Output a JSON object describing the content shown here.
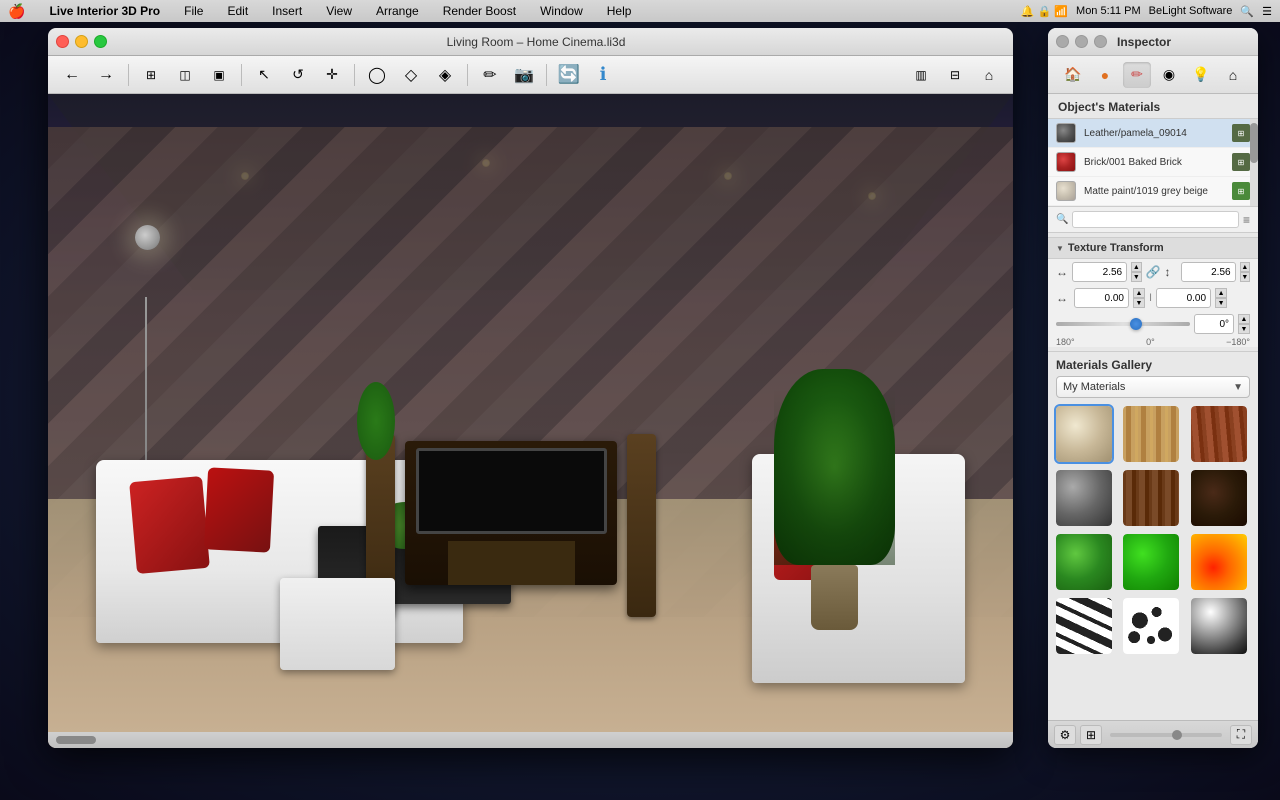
{
  "menubar": {
    "apple": "🍎",
    "app_name": "Live Interior 3D Pro",
    "items": [
      "File",
      "Edit",
      "Insert",
      "View",
      "Arrange",
      "Render Boost",
      "Window",
      "Help"
    ],
    "right": {
      "time": "Mon 5:11 PM",
      "brand": "BeLight Software"
    }
  },
  "window": {
    "title": "Living Room – Home Cinema.li3d",
    "traffic_lights": {
      "close": "close",
      "minimize": "minimize",
      "maximize": "maximize"
    }
  },
  "toolbar": {
    "buttons": [
      {
        "name": "back",
        "icon": "←",
        "label": "Back"
      },
      {
        "name": "forward",
        "icon": "→",
        "label": "Forward"
      },
      {
        "name": "floor-plan",
        "icon": "⊞",
        "label": "Floor Plan"
      },
      {
        "name": "elevation",
        "icon": "◫",
        "label": "Elevation"
      },
      {
        "name": "perspective",
        "icon": "▣",
        "label": "Perspective"
      },
      {
        "name": "select",
        "icon": "↖",
        "label": "Select"
      },
      {
        "name": "orbit",
        "icon": "↺",
        "label": "Orbit"
      },
      {
        "name": "pan",
        "icon": "✛",
        "label": "Pan"
      },
      {
        "name": "sphere-mode",
        "icon": "◯",
        "label": "Sphere"
      },
      {
        "name": "box-mode",
        "icon": "◇",
        "label": "Box"
      },
      {
        "name": "bump-mode",
        "icon": "◈",
        "label": "Bump"
      },
      {
        "name": "draw",
        "icon": "✏",
        "label": "Draw"
      },
      {
        "name": "camera",
        "icon": "📷",
        "label": "Camera"
      },
      {
        "name": "rotate-view",
        "icon": "🔄",
        "label": "Rotate View"
      },
      {
        "name": "info",
        "icon": "ℹ",
        "label": "Info"
      },
      {
        "name": "view-2d",
        "icon": "▥",
        "label": "2D View"
      },
      {
        "name": "view-rooms",
        "icon": "⊟",
        "label": "Rooms View"
      },
      {
        "name": "view-home",
        "icon": "⌂",
        "label": "Home View"
      }
    ]
  },
  "inspector": {
    "title": "Inspector",
    "tabs": [
      {
        "name": "tab-materials",
        "icon": "🏠",
        "active": false
      },
      {
        "name": "tab-sphere",
        "icon": "●",
        "active": false
      },
      {
        "name": "tab-paint",
        "icon": "✏",
        "active": true
      },
      {
        "name": "tab-texture",
        "icon": "◉",
        "active": false
      },
      {
        "name": "tab-light",
        "icon": "💡",
        "active": false
      },
      {
        "name": "tab-home",
        "icon": "⌂",
        "active": false
      }
    ],
    "objects_materials_header": "Object's Materials",
    "materials": [
      {
        "name": "Leather/pamela_09014",
        "color": "#6a6a6a",
        "swatch_type": "dark-gray"
      },
      {
        "name": "Brick/001 Baked Brick",
        "color": "#cc3333",
        "swatch_type": "red"
      },
      {
        "name": "Matte paint/1019 grey beige",
        "color": "#d0c8b8",
        "swatch_type": "beige"
      }
    ],
    "texture_transform": {
      "header": "Texture Transform",
      "width_label": "↔",
      "height_label": "↕",
      "x_label": "↔",
      "y_label": "↕",
      "width_value": "2.56",
      "height_value": "2.56",
      "x_value": "0.00",
      "y_value": "0.00",
      "rotation_value": "0°",
      "rotation_min": "180°",
      "rotation_zero": "0°",
      "rotation_max": "−180°"
    },
    "gallery": {
      "header": "Materials Gallery",
      "dropdown_label": "My Materials",
      "items": [
        {
          "name": "beige-sphere",
          "css_class": "mat-beige-sphere"
        },
        {
          "name": "wood-light",
          "css_class": "mat-wood-light"
        },
        {
          "name": "wood-dark-red",
          "css_class": "mat-wood-dark-red"
        },
        {
          "name": "metal-sphere",
          "css_class": "mat-metal-sphere"
        },
        {
          "name": "brown-wood",
          "css_class": "mat-brown-wood"
        },
        {
          "name": "dark-brown",
          "css_class": "mat-dark-brown"
        },
        {
          "name": "green-sphere",
          "css_class": "mat-green-sphere"
        },
        {
          "name": "bright-green",
          "css_class": "mat-bright-green"
        },
        {
          "name": "fire",
          "css_class": "mat-fire"
        },
        {
          "name": "zebra",
          "css_class": "mat-zebra"
        },
        {
          "name": "dalmatian",
          "css_class": "mat-dalmatian"
        },
        {
          "name": "chrome-sphere",
          "css_class": "mat-chrome-sphere"
        }
      ]
    }
  },
  "viewport": {
    "status_text": ""
  }
}
